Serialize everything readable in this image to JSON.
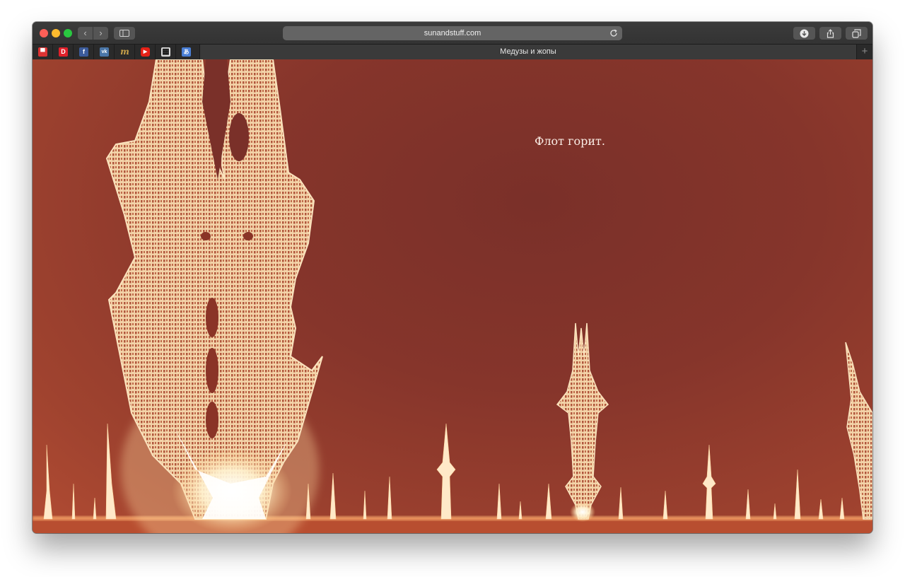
{
  "browser": {
    "url": "sunandstuff.com",
    "active_tab_title": "Медузы и жопы",
    "pinned_tabs": [
      {
        "icon": "mail-icon",
        "glyph": "▀"
      },
      {
        "icon": "dirty-icon",
        "glyph": "D"
      },
      {
        "icon": "facebook-icon",
        "glyph": "f"
      },
      {
        "icon": "vk-icon",
        "glyph": "vk"
      },
      {
        "icon": "meduza-icon",
        "glyph": "m"
      },
      {
        "icon": "youtube-icon",
        "glyph": "▶"
      },
      {
        "icon": "qr-icon",
        "glyph": "▦"
      },
      {
        "icon": "translate-icon",
        "glyph": "あ"
      }
    ],
    "new_tab_glyph": "+"
  },
  "page": {
    "text": "Флот горит."
  },
  "colors": {
    "background": "#86352b",
    "glow": "#fff4d8"
  }
}
